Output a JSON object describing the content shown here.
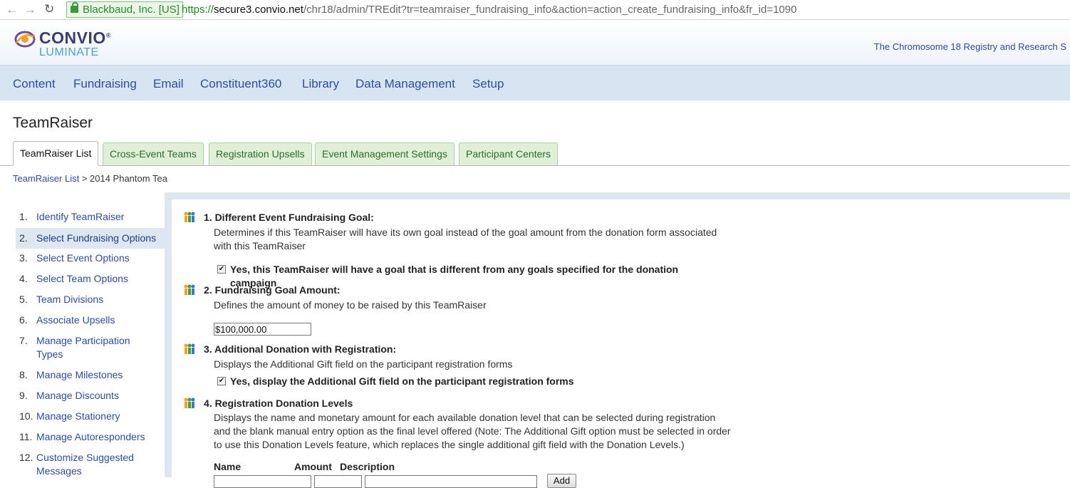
{
  "browser": {
    "ev_label": "Blackbaud, Inc. [US]",
    "url_scheme": "https://",
    "url_host": "secure3.convio.net",
    "url_path": "/chr18/admin/TREdit?tr=teamraiser_fundraising_info&action=action_create_fundraising_info&fr_id=1090"
  },
  "header": {
    "logo_text": "CONVIO",
    "logo_sub": "LUMINATE",
    "org_name": "The Chromosome 18 Registry and Research S"
  },
  "topnav": [
    "Content",
    "Fundraising",
    "Email",
    "Constituent360",
    "Library",
    "Data Management",
    "Setup"
  ],
  "page": {
    "title": "TeamRaiser",
    "tabs": [
      "TeamRaiser List",
      "Cross-Event Teams",
      "Registration Upsells",
      "Event Management Settings",
      "Participant Centers"
    ],
    "active_tab": "TeamRaiser List",
    "breadcrumb_link": "TeamRaiser List",
    "breadcrumb_rest": " > 2014 Phantom Tea"
  },
  "sidebar": {
    "steps": [
      {
        "num": "1.",
        "label": "Identify TeamRaiser"
      },
      {
        "num": "2.",
        "label": "Select Fundraising Options"
      },
      {
        "num": "3.",
        "label": "Select Event Options"
      },
      {
        "num": "4.",
        "label": "Select Team Options"
      },
      {
        "num": "5.",
        "label": "Team Divisions"
      },
      {
        "num": "6.",
        "label": "Associate Upsells"
      },
      {
        "num": "7.",
        "label": "Manage Participation Types"
      },
      {
        "num": "8.",
        "label": "Manage Milestones"
      },
      {
        "num": "9.",
        "label": "Manage Discounts"
      },
      {
        "num": "10.",
        "label": "Manage Stationery"
      },
      {
        "num": "11.",
        "label": "Manage Autoresponders"
      },
      {
        "num": "12.",
        "label": "Customize Suggested Messages"
      }
    ],
    "active_index": 1
  },
  "questions": [
    {
      "title": "1. Different Event Fundraising Goal:",
      "desc": "Determines if this TeamRaiser will have its own goal instead of the goal amount from the donation form associated with this TeamRaiser",
      "checkbox_label": "Yes, this TeamRaiser will have a goal that is different from any goals specified for the donation campaign",
      "checked": true
    },
    {
      "title": "2. Fundraising Goal Amount:",
      "desc": "Defines the amount of money to be raised by this TeamRaiser",
      "input_value": "$100,000.00"
    },
    {
      "title": "3. Additional Donation with Registration:",
      "desc": "Displays the Additional Gift field on the participant registration forms",
      "checkbox_label": "Yes, display the Additional Gift field on the participant registration forms",
      "checked": true
    },
    {
      "title": "4. Registration Donation Levels",
      "desc": "Displays the name and monetary amount for each available donation level that can be selected during registration and the blank manual entry option as the final level offered (Note: The Additional Gift option must be selected in order to use this Donation Levels feature, which replaces the single additional gift field with the Donation Levels.)",
      "columns": [
        "Name",
        "Amount",
        "Description"
      ],
      "add_label": "Add"
    }
  ],
  "colors": {
    "link_blue": "#2b4d9c",
    "nav_bg": "#d7e4f2",
    "tab_green_bg": "#dff0d6",
    "tab_green_text": "#2e6b2e",
    "panel_bg": "#dde7f1"
  }
}
